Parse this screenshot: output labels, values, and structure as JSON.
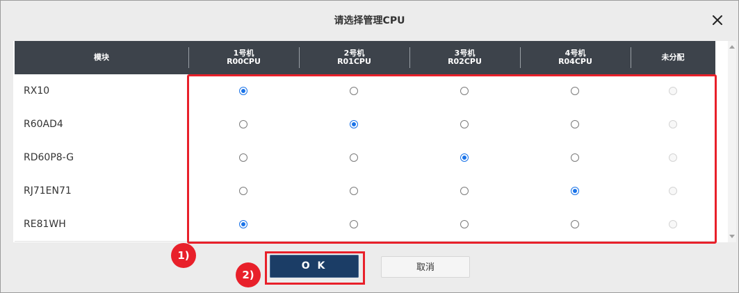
{
  "dialog": {
    "title": "请选择管理CPU",
    "close_icon": "close-icon"
  },
  "table": {
    "columns": [
      {
        "line1": "模块",
        "line2": ""
      },
      {
        "line1": "1号机",
        "line2": "R00CPU"
      },
      {
        "line1": "2号机",
        "line2": "R01CPU"
      },
      {
        "line1": "3号机",
        "line2": "R02CPU"
      },
      {
        "line1": "4号机",
        "line2": "R04CPU"
      },
      {
        "line1": "未分配",
        "line2": ""
      }
    ],
    "rows": [
      {
        "module": "RX10",
        "selected": 0
      },
      {
        "module": "R60AD4",
        "selected": 1
      },
      {
        "module": "RD60P8-G",
        "selected": 2
      },
      {
        "module": "RJ71EN71",
        "selected": 3
      },
      {
        "module": "RE81WH",
        "selected": 0
      }
    ],
    "unassigned_disabled": true
  },
  "annotations": {
    "step1": "1)",
    "step2": "2)",
    "highlight_color": "#e8202a"
  },
  "buttons": {
    "ok": "O K",
    "cancel": "取消"
  },
  "colors": {
    "header_bg": "#3d434b",
    "ok_bg": "#1b3d66",
    "radio_on": "#1a73e8"
  }
}
